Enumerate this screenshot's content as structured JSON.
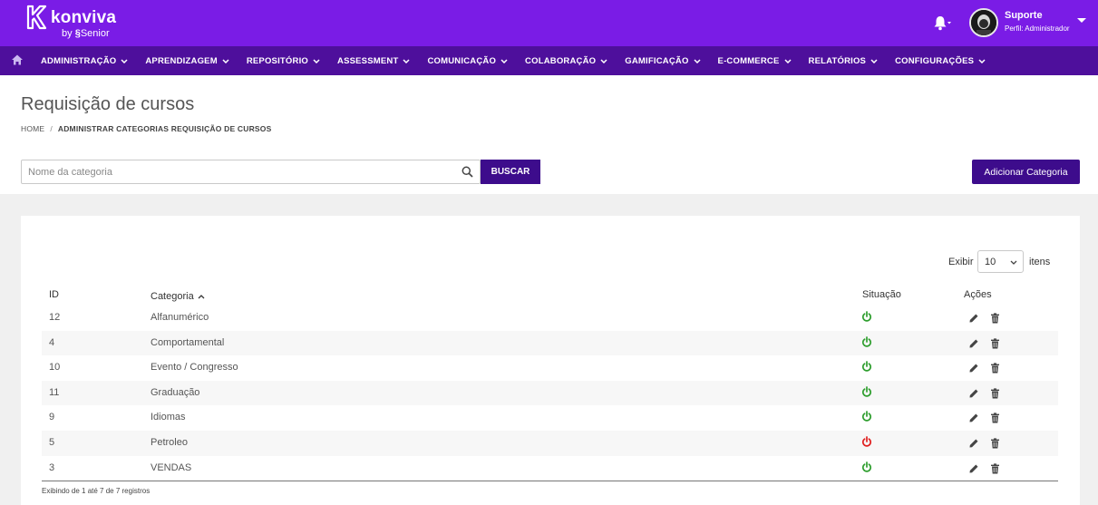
{
  "header": {
    "brand": "konviva",
    "brand_by": "by",
    "brand_sub": "Senior",
    "user_name": "Suporte",
    "user_profile": "Perfil: Administrador"
  },
  "nav": {
    "items": [
      {
        "label": "ADMINISTRAÇÃO"
      },
      {
        "label": "APRENDIZAGEM"
      },
      {
        "label": "REPOSITÓRIO"
      },
      {
        "label": "ASSESSMENT"
      },
      {
        "label": "COMUNICAÇÃO"
      },
      {
        "label": "COLABORAÇÃO"
      },
      {
        "label": "GAMIFICAÇÃO"
      },
      {
        "label": "E-COMMERCE"
      },
      {
        "label": "RELATÓRIOS"
      },
      {
        "label": "CONFIGURAÇÕES"
      }
    ]
  },
  "page": {
    "title": "Requisição de cursos",
    "breadcrumb_home": "HOME",
    "breadcrumb_sep": "/",
    "breadcrumb_current": "ADMINISTRAR CATEGORIAS REQUISIÇÃO DE CURSOS"
  },
  "search": {
    "placeholder": "Nome da categoria",
    "value": "",
    "button": "BUSCAR"
  },
  "add_button": "Adicionar Categoria",
  "table": {
    "show_label": "Exibir",
    "show_value": "10",
    "items_label": "itens",
    "columns": {
      "id": "ID",
      "category": "Categoria",
      "status": "Situação",
      "actions": "Ações"
    },
    "rows": [
      {
        "id": "12",
        "category": "Alfanumérico",
        "active": true
      },
      {
        "id": "4",
        "category": "Comportamental",
        "active": true
      },
      {
        "id": "10",
        "category": "Evento / Congresso",
        "active": true
      },
      {
        "id": "11",
        "category": "Graduação",
        "active": true
      },
      {
        "id": "9",
        "category": "Idiomas",
        "active": true
      },
      {
        "id": "5",
        "category": "Petroleo",
        "active": false
      },
      {
        "id": "3",
        "category": "VENDAS",
        "active": true
      }
    ],
    "footer": "Exibindo de 1 até 7 de 7 registros"
  },
  "colors": {
    "header": "#7a1ce6",
    "nav": "#4e0f9c",
    "button": "#3d0c8c",
    "active": "#2e9e2e",
    "inactive": "#e02020"
  },
  "icons": {
    "home": "home-icon",
    "bell": "bell-icon",
    "search": "search-icon",
    "status": "power-icon",
    "edit": "pencil-icon",
    "delete": "trash-icon"
  }
}
